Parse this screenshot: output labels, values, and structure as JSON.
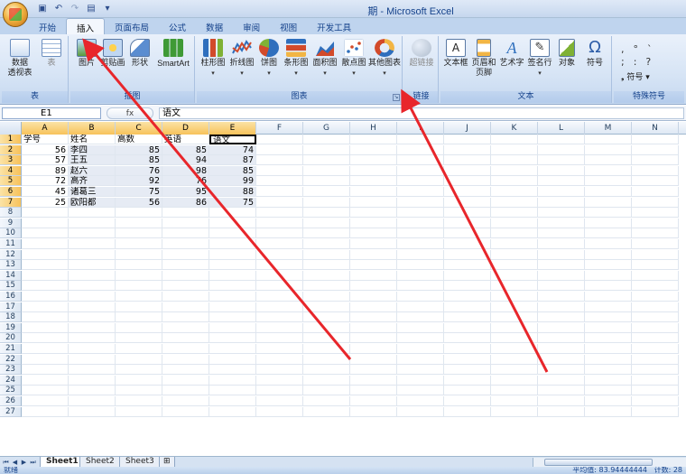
{
  "window": {
    "title": "期 - Microsoft Excel"
  },
  "quick_access": [
    "save-icon",
    "undo-icon",
    "redo-icon",
    "print-preview-icon",
    "dropdown-icon"
  ],
  "tabs": [
    "开始",
    "插入",
    "页面布局",
    "公式",
    "数据",
    "审阅",
    "视图",
    "开发工具"
  ],
  "active_tab": "插入",
  "ribbon": {
    "tables": {
      "label": "表",
      "pivot": "数据\n透视表",
      "table": "表"
    },
    "illustrations": {
      "label": "插图",
      "picture": "图片",
      "clipart": "剪贴画",
      "shapes": "形状",
      "smartart": "SmartArt"
    },
    "charts": {
      "label": "图表",
      "items": [
        "柱形图",
        "折线图",
        "饼图",
        "条形图",
        "面积图",
        "散点图",
        "其他图表"
      ]
    },
    "links": {
      "label": "链接",
      "hyperlink": "超链接"
    },
    "text": {
      "label": "文本",
      "items": [
        "文本框",
        "页眉和\n页脚",
        "艺术字",
        "签名行",
        "对象",
        "符号"
      ]
    },
    "symbols": {
      "label": "特殊符号",
      "symbol": "符号"
    }
  },
  "formula": {
    "name_box": "E1",
    "fx": "fx",
    "content": "语文"
  },
  "columns": [
    "A",
    "B",
    "C",
    "D",
    "E",
    "F",
    "G",
    "H",
    "I",
    "J",
    "K",
    "L",
    "M",
    "N"
  ],
  "rows_count": 27,
  "sheet": {
    "header": [
      "学号",
      "姓名",
      "高数",
      "英语",
      "语文"
    ],
    "data": [
      [
        56,
        "李四",
        85,
        85,
        74
      ],
      [
        57,
        "王五",
        85,
        94,
        87
      ],
      [
        89,
        "赵六",
        76,
        98,
        85
      ],
      [
        72,
        "高齐",
        92,
        76,
        99
      ],
      [
        45,
        "诸葛三",
        75,
        95,
        88
      ],
      [
        25,
        "欧阳都",
        56,
        86,
        75
      ]
    ]
  },
  "sheet_tabs": [
    "Sheet1",
    "Sheet2",
    "Sheet3"
  ],
  "status": {
    "ready": "就绪",
    "average": "平均值: 83.94444444",
    "count": "计数: 28"
  },
  "colors": {
    "annotation": "#e8262b",
    "selected_header": "#f7c25b"
  }
}
